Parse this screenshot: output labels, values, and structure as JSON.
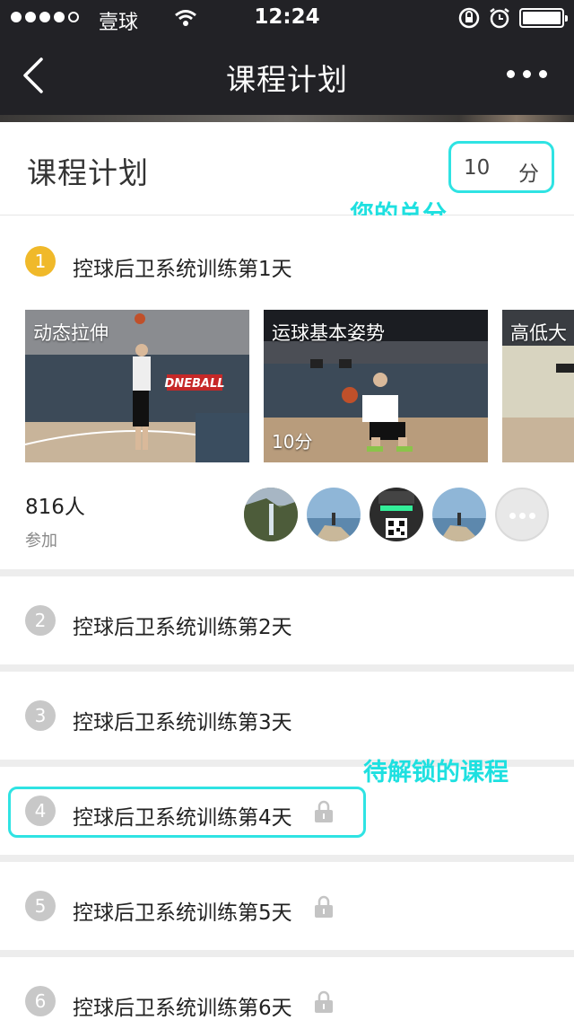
{
  "status_bar": {
    "carrier": "壹球",
    "time": "12:24"
  },
  "nav": {
    "title": "课程计划"
  },
  "header": {
    "title": "课程计划",
    "score_value": "10",
    "score_unit": "分",
    "score_annotation": "您的总分"
  },
  "day1": {
    "number": "1",
    "title": "控球后卫系统训练第1天",
    "videos": [
      {
        "caption": "动态拉伸",
        "points": ""
      },
      {
        "caption": "运球基本姿势",
        "points": "10分"
      },
      {
        "caption": "高低大"
      }
    ],
    "participants_count": "816人",
    "participants_label": "参加"
  },
  "locked_annotation": "待解锁的课程",
  "days": [
    {
      "number": "2",
      "title": "控球后卫系统训练第2天",
      "locked": false
    },
    {
      "number": "3",
      "title": "控球后卫系统训练第3天",
      "locked": false
    },
    {
      "number": "4",
      "title": "控球后卫系统训练第4天",
      "locked": true
    },
    {
      "number": "5",
      "title": "控球后卫系统训练第5天",
      "locked": true
    },
    {
      "number": "6",
      "title": "控球后卫系统训练第6天",
      "locked": true
    }
  ]
}
